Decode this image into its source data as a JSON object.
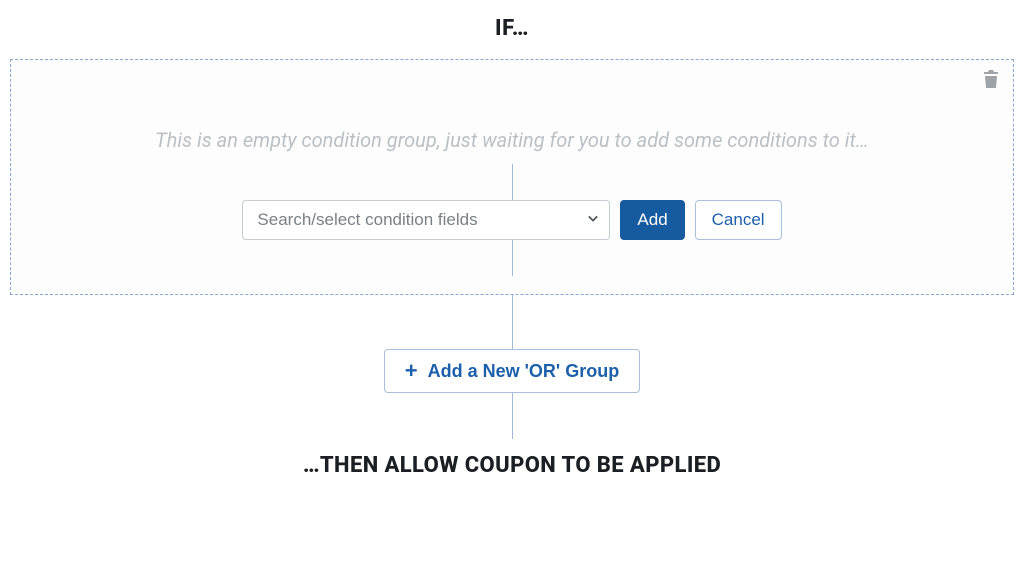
{
  "headings": {
    "if": "IF…",
    "then": "…THEN ALLOW COUPON TO BE APPLIED"
  },
  "group": {
    "empty_hint": "This is an empty condition group, just waiting for you to add some conditions to it…",
    "search_placeholder": "Search/select condition fields",
    "add_label": "Add",
    "cancel_label": "Cancel"
  },
  "or_group": {
    "label": "Add a New 'OR' Group"
  }
}
